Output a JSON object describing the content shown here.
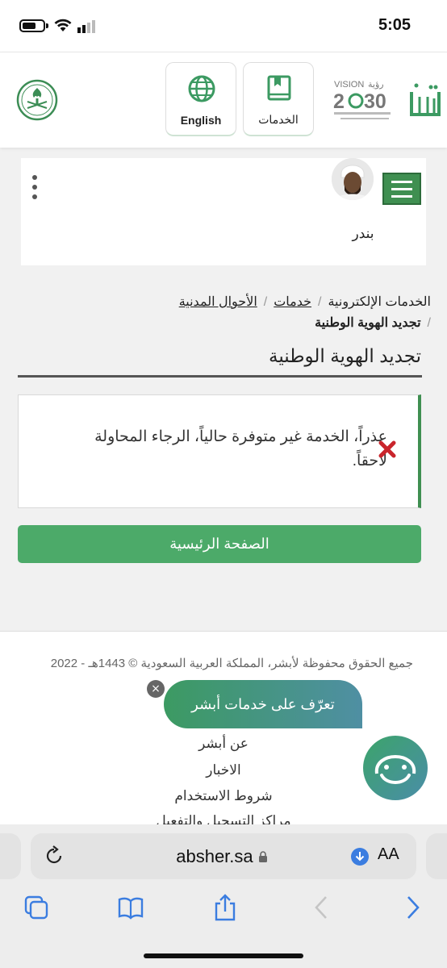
{
  "status_bar": {
    "time": "5:05"
  },
  "header": {
    "services_label": "الخدمات",
    "english_label": "English"
  },
  "user": {
    "name": "بندر"
  },
  "breadcrumb": {
    "items": [
      "الخدمات الإلكترونية",
      "خدمات",
      "الأحوال المدنية"
    ],
    "current": "تجديد الهوية الوطنية"
  },
  "page": {
    "title": "تجديد الهوية الوطنية",
    "alert_text": "عذراً، الخدمة غير متوفرة حالياً، الرجاء المحاولة لاحقاً.",
    "home_button": "الصفحة الرئيسية"
  },
  "footer": {
    "copyright": "جميع الحقوق محفوظة لأبشر، المملكة العربية السعودية © 1443هـ - 2022",
    "links": [
      "عن أبشر",
      "الاخبار",
      "شروط الاستخدام",
      "مراكز التسجيل والتفعيل"
    ]
  },
  "chat": {
    "bubble_text": "تعرّف على خدمات أبشر",
    "close": "×"
  },
  "browser": {
    "url": "absher.sa",
    "text_size": "AA"
  },
  "colors": {
    "primary_green": "#4caa69",
    "dark_green": "#3f8f51",
    "error_red": "#c9252c"
  }
}
